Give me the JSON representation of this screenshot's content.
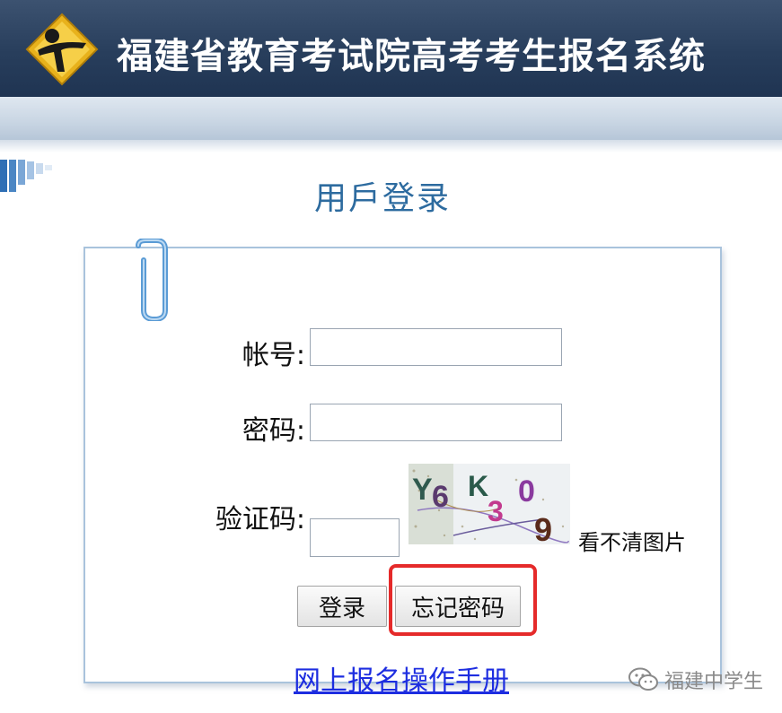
{
  "header": {
    "title": "福建省教育考试院高考考生报名系统",
    "logo_icon": "exam-logo-icon"
  },
  "login": {
    "title": "用戶登录",
    "account_label": "帐号:",
    "account_value": "",
    "password_label": "密码:",
    "password_value": "",
    "captcha_label": "验证码:",
    "captcha_value": "",
    "captcha_image_text": "Y6K309",
    "refresh_captcha_label": "看不清图片",
    "login_button": "登录",
    "forgot_password_button": "忘记密码",
    "manual_link": "网上报名操作手册"
  },
  "watermark": {
    "text": "福建中学生",
    "icon": "wechat-icon"
  },
  "colors": {
    "header_bg": "#283e5c",
    "title_blue": "#2d6b9f",
    "link_blue": "#1d2de0",
    "highlight_red": "#e52a2a"
  }
}
